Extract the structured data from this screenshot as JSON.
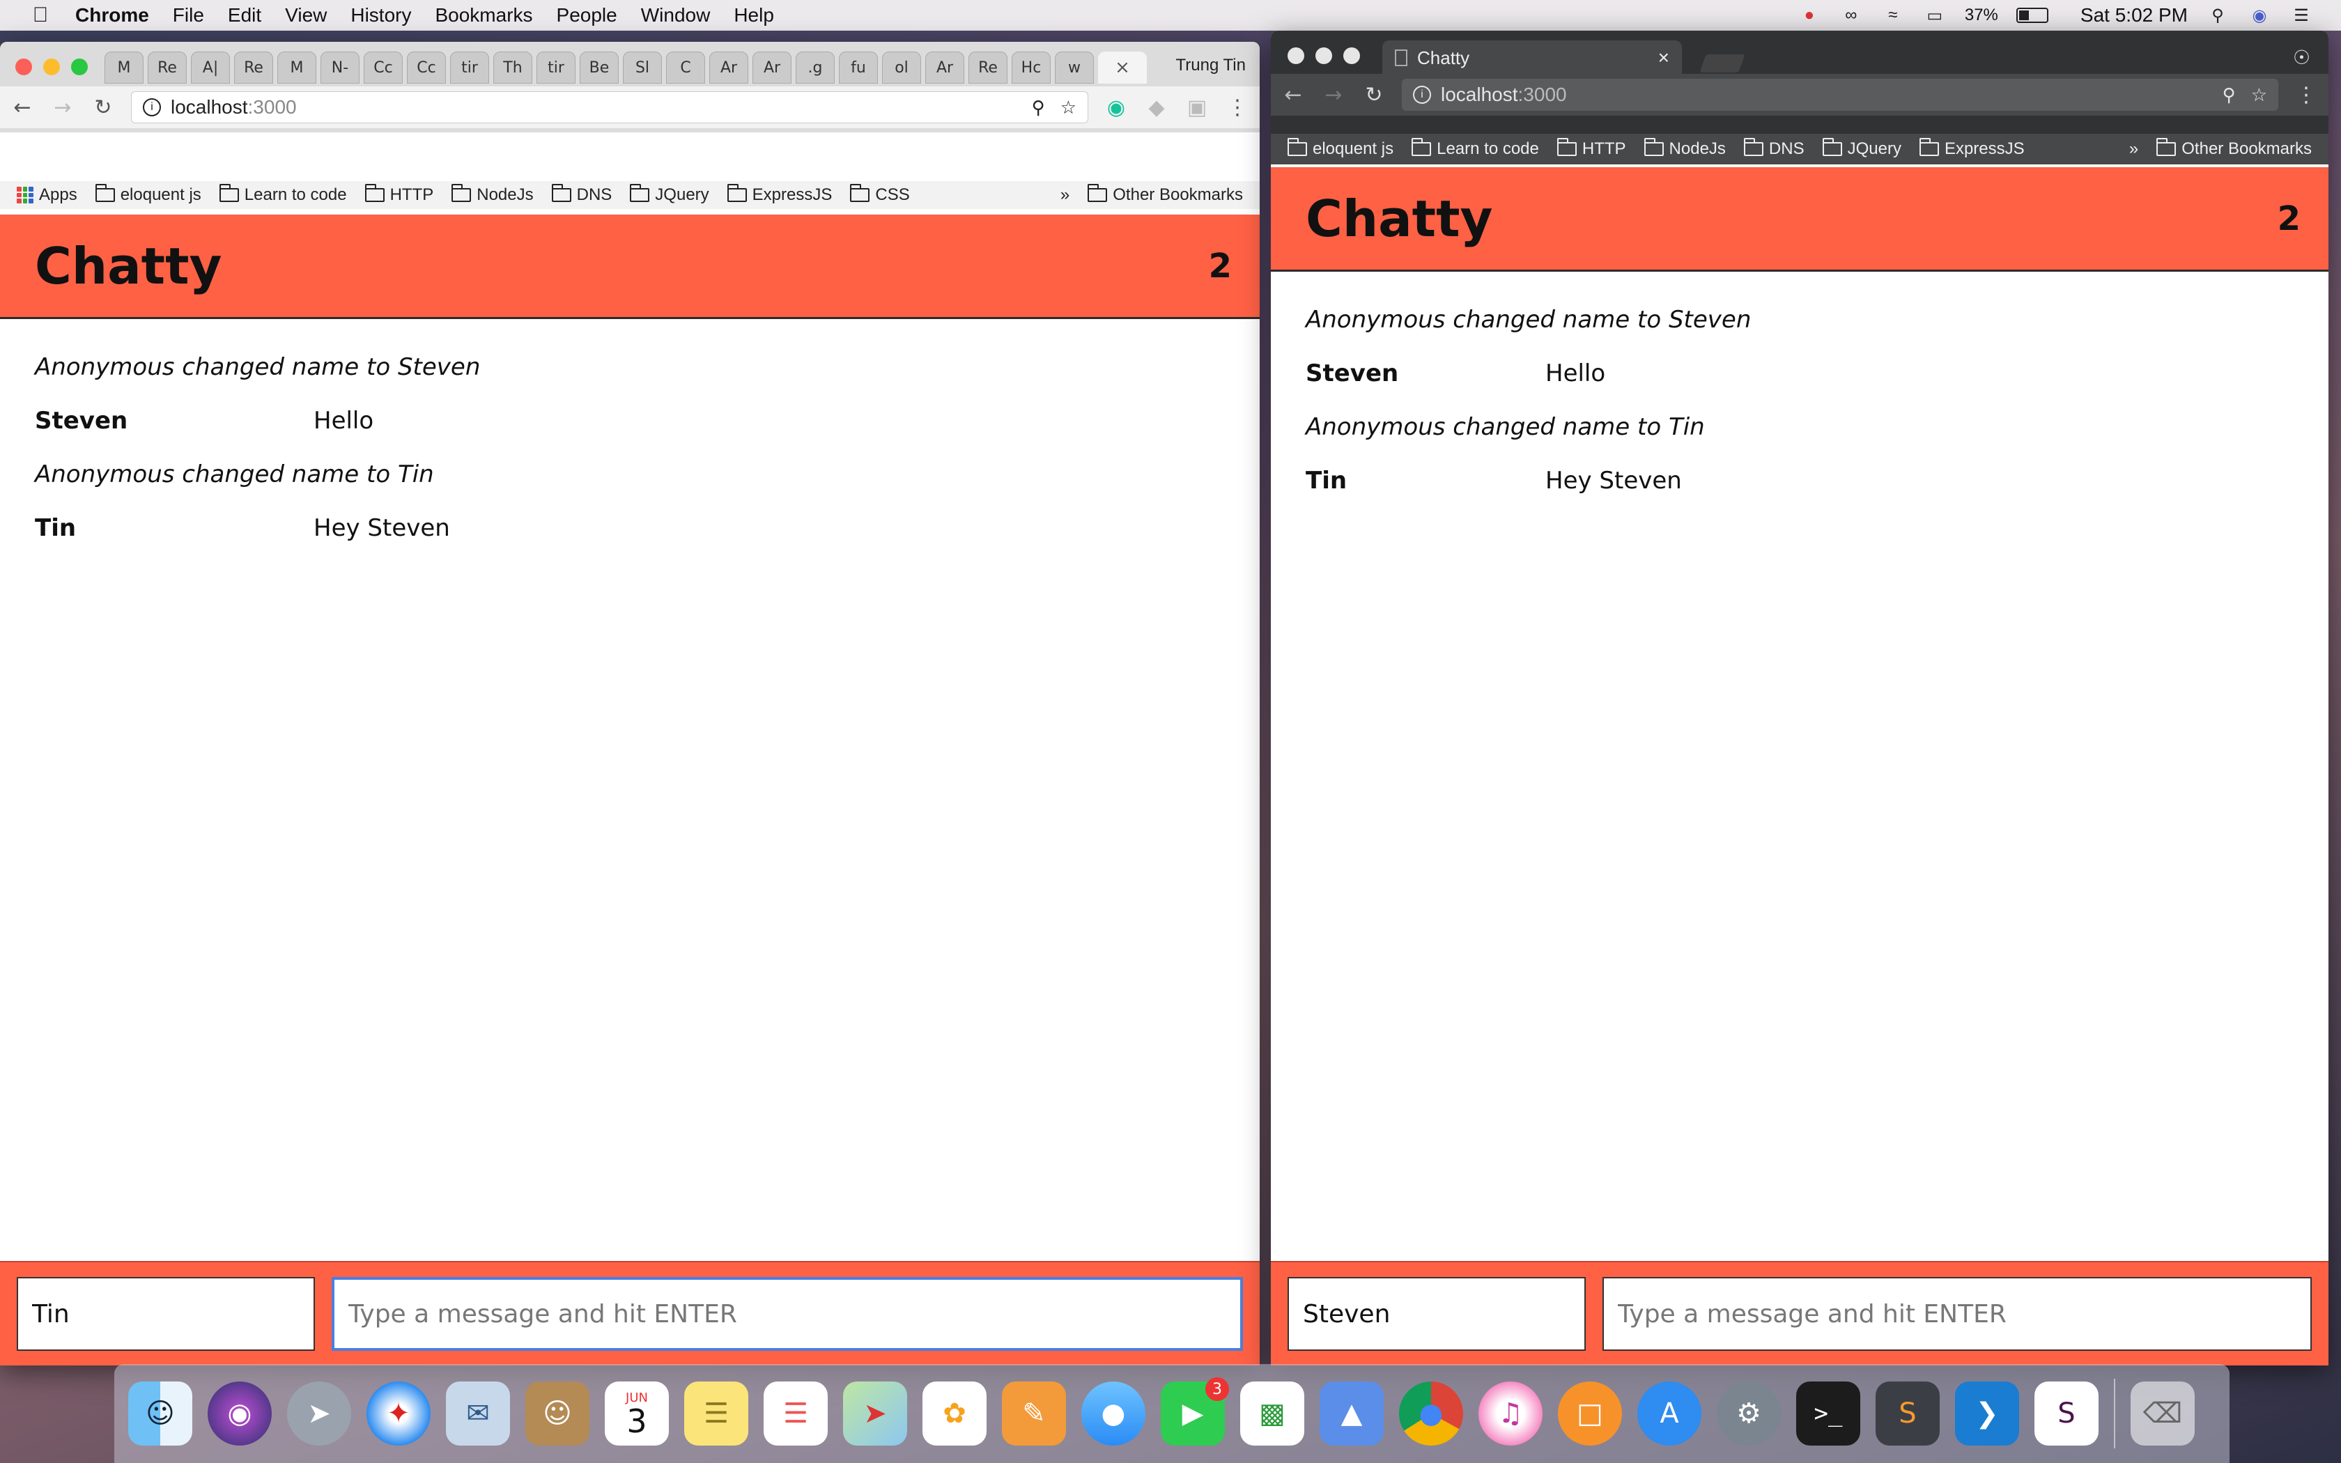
{
  "menubar": {
    "app_name": "Chrome",
    "menus": [
      "File",
      "Edit",
      "View",
      "History",
      "Bookmarks",
      "People",
      "Window",
      "Help"
    ],
    "battery_text": "37%",
    "clock": "Sat 5:02 PM"
  },
  "left_window": {
    "profile_name": "Trung Tin",
    "tab_labels": [
      "M",
      "Re",
      "A|",
      "Re",
      "M",
      "N-",
      "Cc",
      "Cc",
      "tir",
      "Th",
      "tir",
      "Be",
      "Sl",
      "C",
      "Ar",
      "Ar",
      ".g",
      "fu",
      "ol",
      "Ar",
      "Re",
      "Hc",
      "w"
    ],
    "active_tab_close": "×",
    "url_host": "localhost",
    "url_port": ":3000",
    "bookmarks": [
      "eloquent js",
      "Learn to code",
      "HTTP",
      "NodeJs",
      "DNS",
      "JQuery",
      "ExpressJS",
      "CSS"
    ],
    "apps_label": "Apps",
    "bookmarks_more": "»",
    "other_bookmarks": "Other Bookmarks"
  },
  "right_window": {
    "tab_title": "Chatty",
    "tab_close": "×",
    "url_host": "localhost",
    "url_port": ":3000",
    "bookmarks": [
      "eloquent js",
      "Learn to code",
      "HTTP",
      "NodeJs",
      "DNS",
      "JQuery",
      "ExpressJS"
    ],
    "bookmarks_more": "»",
    "other_bookmarks": "Other Bookmarks"
  },
  "chatty": {
    "brand": "Chatty",
    "user_count": "2",
    "messages": [
      {
        "type": "system",
        "text": "Anonymous changed name to Steven"
      },
      {
        "type": "message",
        "user": "Steven",
        "content": "Hello"
      },
      {
        "type": "system",
        "text": "Anonymous changed name to Tin"
      },
      {
        "type": "message",
        "user": "Tin",
        "content": "Hey Steven"
      }
    ],
    "message_placeholder": "Type a message and hit ENTER"
  },
  "left_chatbar": {
    "username": "Tin"
  },
  "right_chatbar": {
    "username": "Steven"
  },
  "dock": {
    "calendar_month": "JUN",
    "calendar_day": "3",
    "facetime_badge": "3"
  }
}
